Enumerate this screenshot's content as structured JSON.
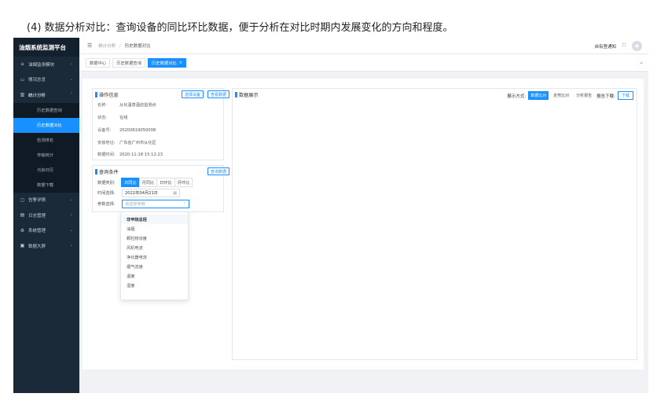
{
  "caption": "(4) 数据分析对比：查询设备的同比环比数据，便于分析在对比时期内发展变化的方向和程度。",
  "app": {
    "title": "油烟系统监测平台"
  },
  "sidebar": {
    "items": [
      {
        "label": "油烟监测模块",
        "icon": "home-icon"
      },
      {
        "label": "情况总览",
        "icon": "monitor-icon"
      },
      {
        "label": "统计分析",
        "icon": "bar-chart-icon"
      },
      {
        "label": "告警详情",
        "icon": "alert-icon"
      },
      {
        "label": "日志管理",
        "icon": "document-icon"
      },
      {
        "label": "系统管理",
        "icon": "gear-icon"
      },
      {
        "label": "数据大屏",
        "icon": "screen-icon"
      }
    ],
    "sub_items": [
      {
        "label": "历史数据查询"
      },
      {
        "label": "历史数据对比"
      },
      {
        "label": "检测排名"
      },
      {
        "label": "传输统计"
      },
      {
        "label": "污染日历"
      },
      {
        "label": "数据下载"
      }
    ]
  },
  "header": {
    "breadcrumb": [
      "统计分析",
      "历史数据对比"
    ],
    "notify": "自有登通知",
    "expand": "⛶"
  },
  "tabs": [
    {
      "label": "数据中心"
    },
    {
      "label": "历史数据查询"
    },
    {
      "label": "历史数据对比"
    }
  ],
  "device_info": {
    "title": "操作信息",
    "select_btn": "选择设备",
    "view_btn": "查看数据",
    "rows": [
      {
        "label": "名称:",
        "value": "从化温泉酒店监测点"
      },
      {
        "label": "状态:",
        "value": "在线"
      },
      {
        "label": "设备号:",
        "value": "20200619050008"
      },
      {
        "label": "安装地址:",
        "value": "广东省广州市从化区"
      },
      {
        "label": "数据时间:",
        "value": "2020-11-18 15:12:23"
      }
    ]
  },
  "query": {
    "title": "查询条件",
    "query_btn": "查询数据",
    "type_label": "数据类别:",
    "types": [
      "日同比",
      "月同比",
      "日环比",
      "月环比"
    ],
    "active_type": "日同比",
    "time_label": "时间选择:",
    "date_value": "2022年04月21日",
    "param_label": "参数选择:",
    "param_placeholder": "请选择参数"
  },
  "dropdown": {
    "options": [
      "非甲烷总烃",
      "油烟",
      "颗粒物浓度",
      "风机电流",
      "净化器电流",
      "烟气流速",
      "温度",
      "湿度"
    ],
    "selected": "非甲烷总烃"
  },
  "chart_panel": {
    "title": "数据展示",
    "mode_label": "展示方式:",
    "modes": [
      "数据比对",
      "走势比对",
      "分析报告"
    ],
    "active_mode": "数据比对",
    "download_label": "报告下载:",
    "download_btn": "下载"
  },
  "colors": {
    "primary": "#1890ff",
    "sidebar": "#1b2a38"
  }
}
